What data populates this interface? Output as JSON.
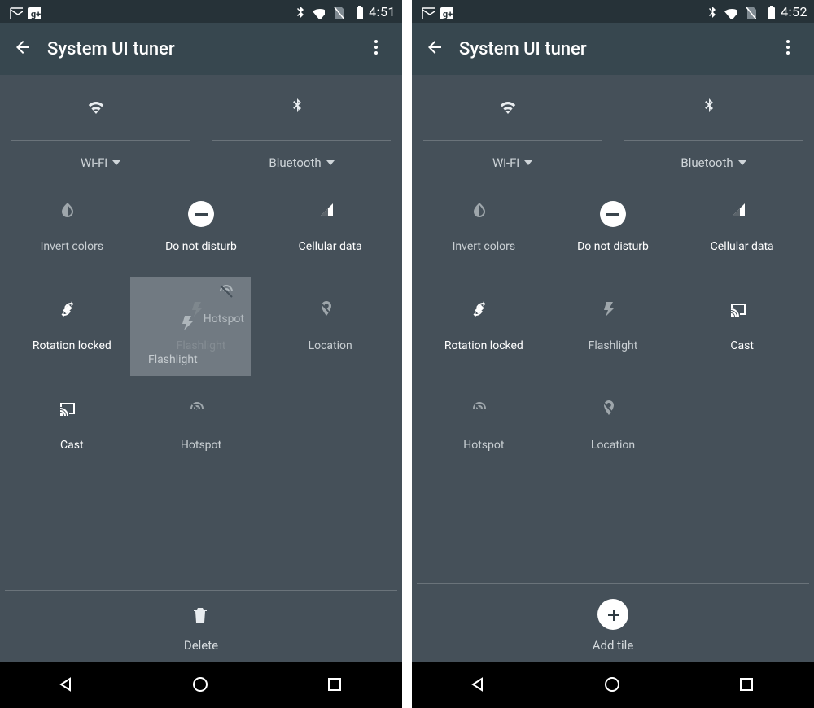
{
  "screens": [
    {
      "status": {
        "time": "4:51"
      },
      "appbar": {
        "title": "System UI tuner"
      },
      "top": [
        {
          "label": "Wi-Fi",
          "icon": "wifi"
        },
        {
          "label": "Bluetooth",
          "icon": "bluetooth"
        }
      ],
      "tiles": [
        {
          "label": "Invert colors",
          "icon": "invert",
          "active": false
        },
        {
          "label": "Do not disturb",
          "icon": "dnd",
          "active": true
        },
        {
          "label": "Cellular data",
          "icon": "cell",
          "active": true
        },
        {
          "label": "Rotation locked",
          "icon": "rotation",
          "active": true
        },
        {
          "label": "Flashlight",
          "icon": "flashlight",
          "active": false,
          "dragging": true
        },
        {
          "label": "Location",
          "icon": "location",
          "active": false
        },
        {
          "label": "Cast",
          "icon": "cast",
          "active": true
        },
        {
          "label": "Hotspot",
          "icon": "hotspot",
          "active": false
        }
      ],
      "ghost": {
        "primary": "Flashlight",
        "secondary": "Hotspot"
      },
      "bottom": {
        "type": "delete",
        "label": "Delete"
      }
    },
    {
      "status": {
        "time": "4:52"
      },
      "appbar": {
        "title": "System UI tuner"
      },
      "top": [
        {
          "label": "Wi-Fi",
          "icon": "wifi"
        },
        {
          "label": "Bluetooth",
          "icon": "bluetooth"
        }
      ],
      "tiles": [
        {
          "label": "Invert colors",
          "icon": "invert",
          "active": false
        },
        {
          "label": "Do not disturb",
          "icon": "dnd",
          "active": true
        },
        {
          "label": "Cellular data",
          "icon": "cell",
          "active": true
        },
        {
          "label": "Rotation locked",
          "icon": "rotation",
          "active": true
        },
        {
          "label": "Flashlight",
          "icon": "flashlight",
          "active": false
        },
        {
          "label": "Cast",
          "icon": "cast",
          "active": true
        },
        {
          "label": "Hotspot",
          "icon": "hotspot",
          "active": false
        },
        {
          "label": "Location",
          "icon": "location",
          "active": false
        }
      ],
      "bottom": {
        "type": "add",
        "label": "Add tile"
      }
    }
  ]
}
